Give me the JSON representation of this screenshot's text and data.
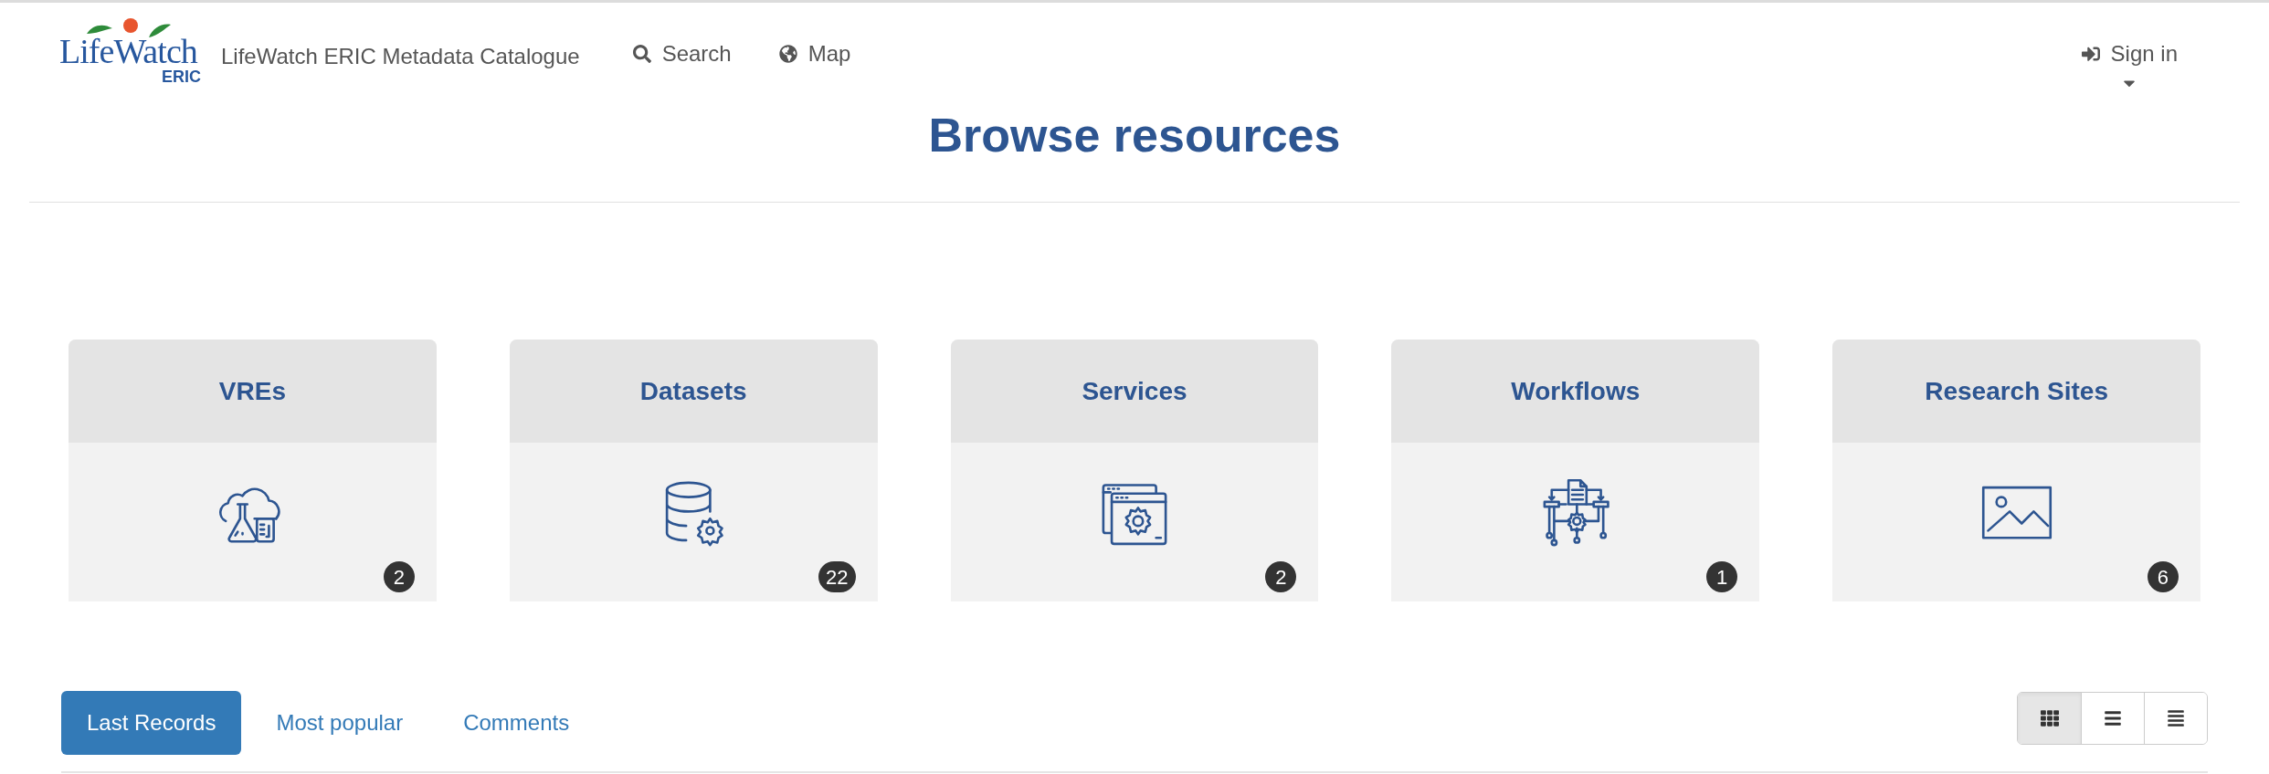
{
  "header": {
    "logo": {
      "word": "LifeWatch",
      "sub": "ERIC"
    },
    "site_title": "LifeWatch ERIC Metadata Catalogue",
    "nav": [
      {
        "label": "Search",
        "kind": "search"
      },
      {
        "label": "Map",
        "kind": "map"
      }
    ],
    "sign_in": {
      "label": "Sign in"
    }
  },
  "page_title": "Browse resources",
  "categories": [
    {
      "title": "VREs",
      "kind": "vre",
      "count": "2"
    },
    {
      "title": "Datasets",
      "kind": "dataset",
      "count": "22"
    },
    {
      "title": "Services",
      "kind": "service",
      "count": "2"
    },
    {
      "title": "Workflows",
      "kind": "workflow",
      "count": "1"
    },
    {
      "title": "Research Sites",
      "kind": "site",
      "count": "6"
    }
  ],
  "tabs": [
    {
      "label": "Last Records",
      "selected": true
    },
    {
      "label": "Most popular",
      "selected": false
    },
    {
      "label": "Comments",
      "selected": false
    }
  ],
  "view_modes": [
    {
      "kind": "grid",
      "selected": true
    },
    {
      "kind": "list",
      "selected": false
    },
    {
      "kind": "table",
      "selected": false
    }
  ]
}
